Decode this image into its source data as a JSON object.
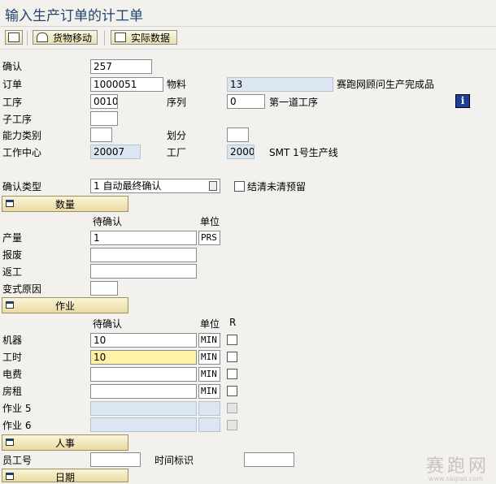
{
  "window": {
    "title": "输入生产订单的计工单"
  },
  "toolbar": {
    "goods_movement": "货物移动",
    "actual_data": "实际数据"
  },
  "header": {
    "confirmation_label": "确认",
    "confirmation_value": "257",
    "order_label": "订单",
    "order_value": "1000051",
    "material_label": "物料",
    "material_value": "13",
    "material_desc": "赛跑网顾问生产完成品",
    "operation_label": "工序",
    "operation_value": "0010",
    "sequence_label": "序列",
    "sequence_value": "0",
    "sequence_desc": "第一道工序",
    "sub_operation_label": "子工序",
    "sub_operation_value": "",
    "capacity_category_label": "能力类别",
    "capacity_category_value": "",
    "split_label": "划分",
    "split_value": "",
    "work_center_label": "工作中心",
    "work_center_value": "20007",
    "plant_label": "工厂",
    "plant_value": "2000",
    "plant_desc": "SMT 1号生产线",
    "info_icon": "i"
  },
  "confirmation_type": {
    "label": "确认类型",
    "value": "1 自动最终确认",
    "clear_reservations_label": "结清未清预留"
  },
  "quantities": {
    "section_title": "数量",
    "col_to_confirm": "待确认",
    "col_unit": "单位",
    "yield_label": "产量",
    "yield_value": "1",
    "yield_unit": "PRS",
    "scrap_label": "报废",
    "scrap_value": "",
    "rework_label": "返工",
    "rework_value": "",
    "variance_label": "变式原因",
    "variance_value": ""
  },
  "activities": {
    "section_title": "作业",
    "col_to_confirm": "待确认",
    "col_unit": "单位",
    "col_r": "R",
    "rows": [
      {
        "label": "机器",
        "value": "10",
        "unit": "MIN"
      },
      {
        "label": "工时",
        "value": "10",
        "unit": "MIN"
      },
      {
        "label": "电费",
        "value": "",
        "unit": "MIN"
      },
      {
        "label": "房租",
        "value": "",
        "unit": "MIN"
      },
      {
        "label": "作业 5",
        "value": "",
        "unit": ""
      },
      {
        "label": "作业 6",
        "value": "",
        "unit": ""
      }
    ]
  },
  "personnel": {
    "section_title": "人事",
    "personnel_no_label": "员工号",
    "personnel_no_value": "",
    "time_id_label": "时间标识",
    "time_id_value": ""
  },
  "dates": {
    "section_title": "日期"
  },
  "watermark": {
    "text": "赛跑网",
    "url": "www.saipao.com"
  },
  "colors": {
    "title": "#22446e",
    "readonly_field": "#dce6f2",
    "highlight_field": "#fff1a6",
    "section_button": "#eadba4"
  }
}
